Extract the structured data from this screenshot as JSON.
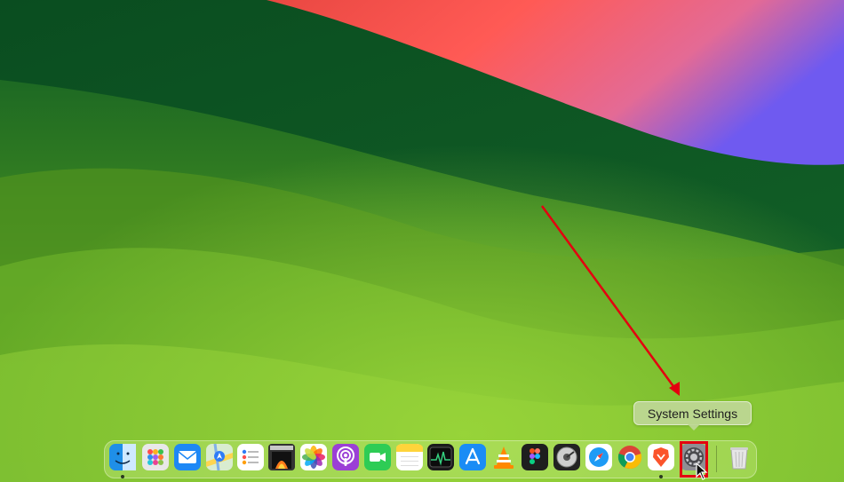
{
  "tooltip": {
    "text": "System Settings"
  },
  "dock": {
    "apps": [
      {
        "name": "finder-icon",
        "running": true
      },
      {
        "name": "launchpad-icon",
        "running": false
      },
      {
        "name": "mail-icon",
        "running": false
      },
      {
        "name": "maps-icon",
        "running": false
      },
      {
        "name": "reminders-icon",
        "running": false
      },
      {
        "name": "photo-booth-icon",
        "running": false
      },
      {
        "name": "photos-icon",
        "running": false
      },
      {
        "name": "podcasts-icon",
        "running": false
      },
      {
        "name": "facetime-icon",
        "running": false
      },
      {
        "name": "notes-icon",
        "running": false
      },
      {
        "name": "activity-monitor-icon",
        "running": false
      },
      {
        "name": "app-store-icon",
        "running": false
      },
      {
        "name": "vlc-icon",
        "running": false
      },
      {
        "name": "figma-icon",
        "running": false
      },
      {
        "name": "disk-utility-icon",
        "running": false
      },
      {
        "name": "safari-icon",
        "running": false
      },
      {
        "name": "chrome-icon",
        "running": false
      },
      {
        "name": "brave-icon",
        "running": true
      },
      {
        "name": "system-settings-icon",
        "running": false
      },
      {
        "name": "trash-icon",
        "running": false
      }
    ]
  },
  "colors": {
    "annotation": "#e3000f",
    "wallpaper_green": "#5a9a1e",
    "wallpaper_red": "#ff5050",
    "wallpaper_purple": "#6a5ae8"
  }
}
